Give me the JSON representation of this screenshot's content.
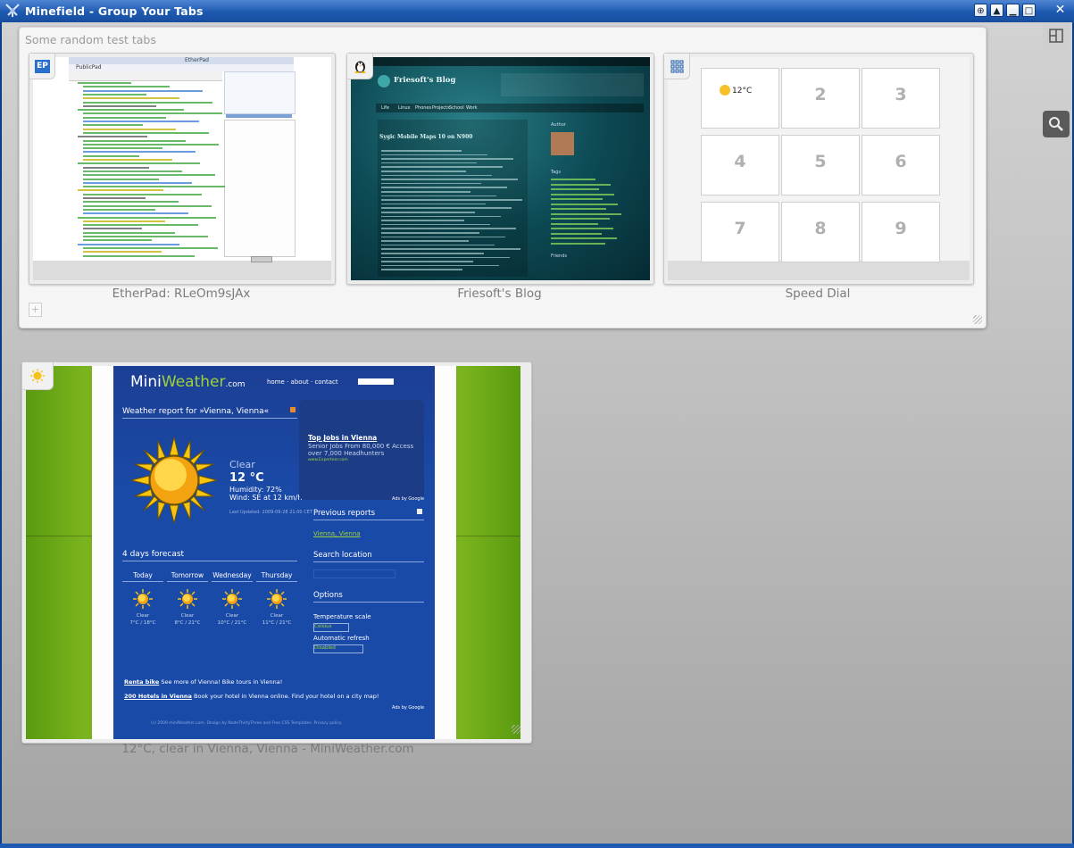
{
  "window": {
    "title": "Minefield - Group Your Tabs",
    "buttons": {
      "menu": "⊕",
      "shade": "▲",
      "minimize": "▁",
      "maximize": "□",
      "close": "✕"
    }
  },
  "group": {
    "title": "Some random test tabs",
    "add_glyph": "+",
    "tabs": [
      {
        "label": "EtherPad: RLeOm9sJAx",
        "favicon": "EP"
      },
      {
        "label": "Friesoft's Blog",
        "favicon": "tux-icon"
      },
      {
        "label": "Speed Dial",
        "favicon": "grid-icon"
      }
    ]
  },
  "etherpad": {
    "pad_title": "PublicPad",
    "top_bar": "EtherPad"
  },
  "blog": {
    "site_title": "Friesoft's Blog",
    "post_title": "Sygic Mobile Maps 10 on N900",
    "sidebar_author": "Author",
    "sidebar_tags": "Tags",
    "sidebar_friends": "Friends",
    "nav": [
      "Life",
      "Linux",
      "Phones",
      "Projects",
      "School",
      "Work"
    ]
  },
  "speeddial": {
    "weather_mini": "12°C",
    "numbers": [
      "2",
      "3",
      "4",
      "5",
      "6",
      "7",
      "8",
      "9"
    ]
  },
  "standalone_tab": {
    "label": "12°C, clear in Vienna, Vienna - MiniWeather.com",
    "favicon": "sun-icon"
  },
  "miniweather": {
    "logo_mini": "Mini",
    "logo_weather": "Weather",
    "logo_com": ".com",
    "nav": [
      "home",
      "about",
      "contact"
    ],
    "report_title": "Weather report for »Vienna, Vienna«",
    "condition": "Clear",
    "temperature": "12 °C",
    "humidity": "Humidity: 72%",
    "wind": "Wind: SE at 12 km/h",
    "updated": "Last Updated: 2009-09-28 21:00 CET",
    "forecast_title": "4 days forecast",
    "days": [
      {
        "name": "Today",
        "cond": "Clear",
        "temps": "7°C / 18°C"
      },
      {
        "name": "Tomorrow",
        "cond": "Clear",
        "temps": "8°C / 21°C"
      },
      {
        "name": "Wednesday",
        "cond": "Clear",
        "temps": "10°C / 21°C"
      },
      {
        "name": "Thursday",
        "cond": "Clear",
        "temps": "11°C / 21°C"
      }
    ],
    "ad_title": "Top Jobs in Vienna",
    "ad_line1": "Senior Jobs From 80,000 € Access",
    "ad_line2": "over 7,000 Headhunters",
    "ad_url": "www.Experteer.com",
    "ads_by": "Ads by Google",
    "previous_reports": "Previous reports",
    "previous_link": "Vienna, Vienna",
    "search_location": "Search location",
    "options": "Options",
    "temp_scale_label": "Temperature scale",
    "temp_scale_value": "Celsius",
    "auto_refresh_label": "Automatic refresh",
    "auto_refresh_value": "Disabled",
    "bottom_link1": "Renta bike",
    "bottom_text1": "See more of Vienna! Bike tours in Vienna!",
    "bottom_link2": "200 Hotels in Vienna",
    "bottom_text2": "Book your hotel in Vienna online. Find your hotel on a city map!",
    "footer": "(c) 2009 miniWeather.com. Design by NodeThirtyThree and Free CSS Templates. Privacy policy."
  },
  "colors": {
    "titlebar": "#1d59b1",
    "group_bg": "#f5f5f5",
    "label_text": "#7b7b7b",
    "blog_teal": "#0f5b66",
    "miniweather_blue": "#1a4aa8",
    "grass_green": "#6aa516"
  }
}
